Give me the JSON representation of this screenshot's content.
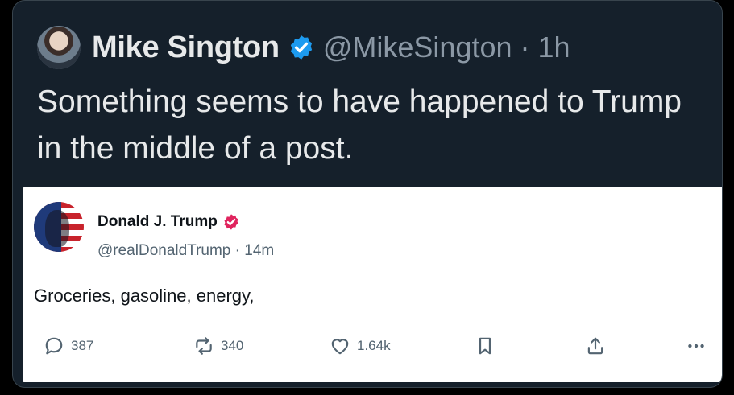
{
  "tweet": {
    "author": {
      "display_name": "Mike Sington",
      "handle_time": "@MikeSington · 1h",
      "avatar_icon": "profile-photo"
    },
    "text": "Something seems to have happened to Trump in the middle of a post.",
    "colors": {
      "background": "#15202b",
      "text": "#e7e9ea",
      "muted": "#8b98a5",
      "verified": "#1d9bf0"
    }
  },
  "embed": {
    "author": {
      "display_name": "Donald J. Trump",
      "handle_time": "@realDonaldTrump · 14m",
      "avatar_icon": "flag-portrait-avatar"
    },
    "text": "Groceries, gasoline, energy,",
    "actions": {
      "reply_count": "387",
      "repost_count": "340",
      "like_count": "1.64k"
    },
    "colors": {
      "verified": "#e0245e",
      "text": "#0f1419",
      "muted": "#536471"
    }
  }
}
